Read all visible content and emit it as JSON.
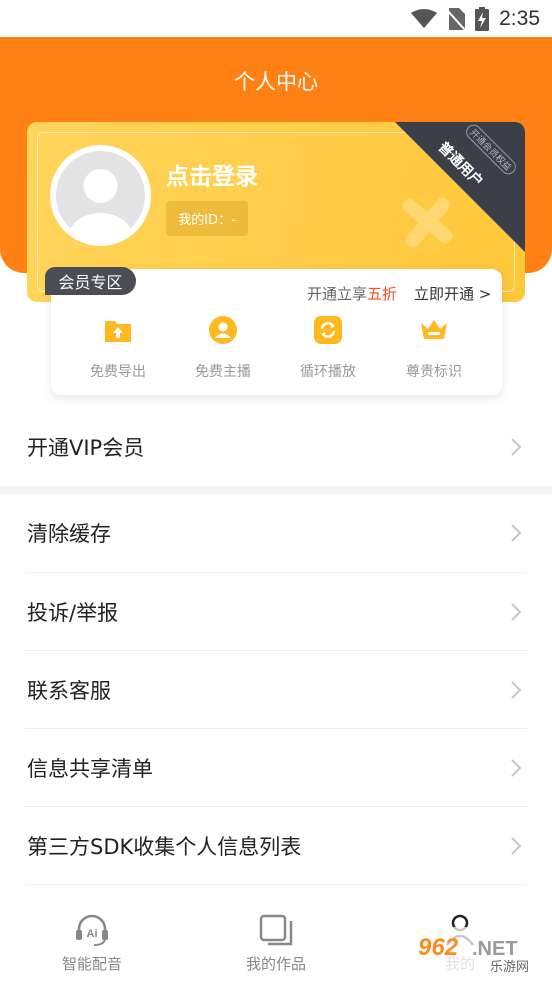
{
  "status_bar": {
    "time": "2:35"
  },
  "header": {
    "title": "个人中心"
  },
  "card": {
    "login_text": "点击登录",
    "id_label": "我的ID：-",
    "corner_label": "普通用户",
    "corner_sub": "开通会员权益"
  },
  "vip": {
    "badge": "会员专区",
    "promo_prefix": "开通立享",
    "promo_highlight": "五折",
    "open_button": "立即开通 >",
    "features": [
      {
        "label": "免费导出",
        "icon": "export-icon"
      },
      {
        "label": "免费主播",
        "icon": "anchor-icon"
      },
      {
        "label": "循环播放",
        "icon": "loop-icon"
      },
      {
        "label": "尊贵标识",
        "icon": "crown-icon"
      }
    ],
    "accent": "#ffb820"
  },
  "menu": [
    {
      "label": "开通VIP会员"
    },
    {
      "label": "清除缓存"
    },
    {
      "label": "投诉/举报"
    },
    {
      "label": "联系客服"
    },
    {
      "label": "信息共享清单"
    },
    {
      "label": "第三方SDK收集个人信息列表"
    }
  ],
  "tabs": [
    {
      "label": "智能配音",
      "icon": "ai-headset-icon"
    },
    {
      "label": "我的作品",
      "icon": "works-icon"
    },
    {
      "label": "我的",
      "icon": "profile-icon"
    }
  ],
  "watermark": {
    "text": "962.NET",
    "sub": "乐游网"
  },
  "colors": {
    "brand": "#ff8114",
    "card": "#ffcc47",
    "dark": "#3b3f4a"
  }
}
